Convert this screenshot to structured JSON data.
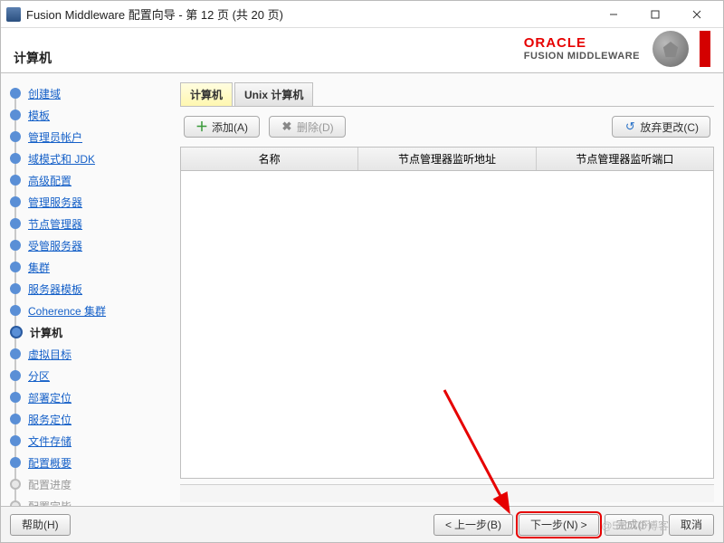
{
  "window": {
    "title": "Fusion Middleware 配置向导 - 第 12 页 (共 20 页)"
  },
  "header": {
    "page_title": "计算机",
    "brand_top": "ORACLE",
    "brand_sub": "FUSION MIDDLEWARE"
  },
  "sidebar": {
    "steps": [
      {
        "label": "创建域",
        "state": "completed"
      },
      {
        "label": "模板",
        "state": "completed"
      },
      {
        "label": "管理员帐户",
        "state": "completed"
      },
      {
        "label": "域模式和 JDK",
        "state": "completed"
      },
      {
        "label": "高级配置",
        "state": "completed"
      },
      {
        "label": "管理服务器",
        "state": "completed"
      },
      {
        "label": "节点管理器",
        "state": "completed"
      },
      {
        "label": "受管服务器",
        "state": "completed"
      },
      {
        "label": "集群",
        "state": "completed"
      },
      {
        "label": "服务器模板",
        "state": "completed"
      },
      {
        "label": "Coherence 集群",
        "state": "completed"
      },
      {
        "label": "计算机",
        "state": "current"
      },
      {
        "label": "虚拟目标",
        "state": "completed"
      },
      {
        "label": "分区",
        "state": "completed"
      },
      {
        "label": "部署定位",
        "state": "completed"
      },
      {
        "label": "服务定位",
        "state": "completed"
      },
      {
        "label": "文件存储",
        "state": "completed"
      },
      {
        "label": "配置概要",
        "state": "completed"
      },
      {
        "label": "配置进度",
        "state": "disabled"
      },
      {
        "label": "配置完毕",
        "state": "disabled"
      }
    ]
  },
  "tabs": {
    "items": [
      {
        "label": "计算机",
        "active": true
      },
      {
        "label": "Unix 计算机",
        "active": false
      }
    ]
  },
  "toolbar": {
    "add": "添加(A)",
    "delete": "删除(D)",
    "discard": "放弃更改(C)"
  },
  "table": {
    "columns": [
      "名称",
      "节点管理器监听地址",
      "节点管理器监听端口"
    ]
  },
  "footer": {
    "help": "帮助(H)",
    "back": "上一步(B)",
    "next": "下一步(N)",
    "finish": "完成(F)",
    "cancel": "取消"
  },
  "watermark": "@51CTO博客"
}
